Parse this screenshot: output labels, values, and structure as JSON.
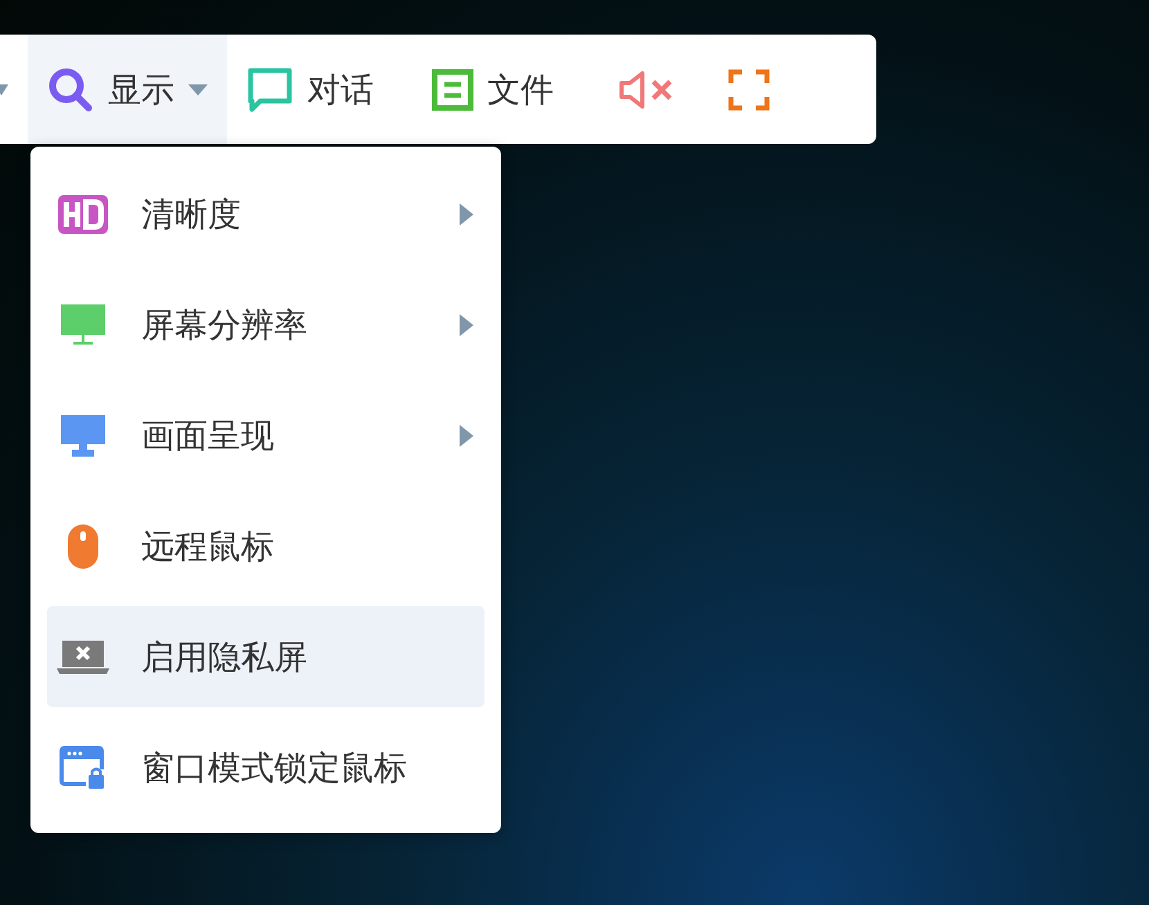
{
  "toolbar": {
    "items": [
      {
        "kind": "caret"
      },
      {
        "kind": "dropdown",
        "label": "显示",
        "selected": true
      },
      {
        "kind": "button",
        "label": "对话",
        "selected": false
      },
      {
        "kind": "button",
        "label": "文件",
        "selected": false
      },
      {
        "kind": "icon"
      },
      {
        "kind": "icon"
      }
    ]
  },
  "menu": {
    "items": [
      {
        "label": "清晰度",
        "submenu": true,
        "selected": false
      },
      {
        "label": "屏幕分辨率",
        "submenu": true,
        "selected": false
      },
      {
        "label": "画面呈现",
        "submenu": true,
        "selected": false
      },
      {
        "label": "远程鼠标",
        "submenu": false,
        "selected": false
      },
      {
        "label": "启用隐私屏",
        "submenu": false,
        "selected": true
      },
      {
        "label": "窗口模式锁定鼠标",
        "submenu": false,
        "selected": false
      }
    ]
  }
}
